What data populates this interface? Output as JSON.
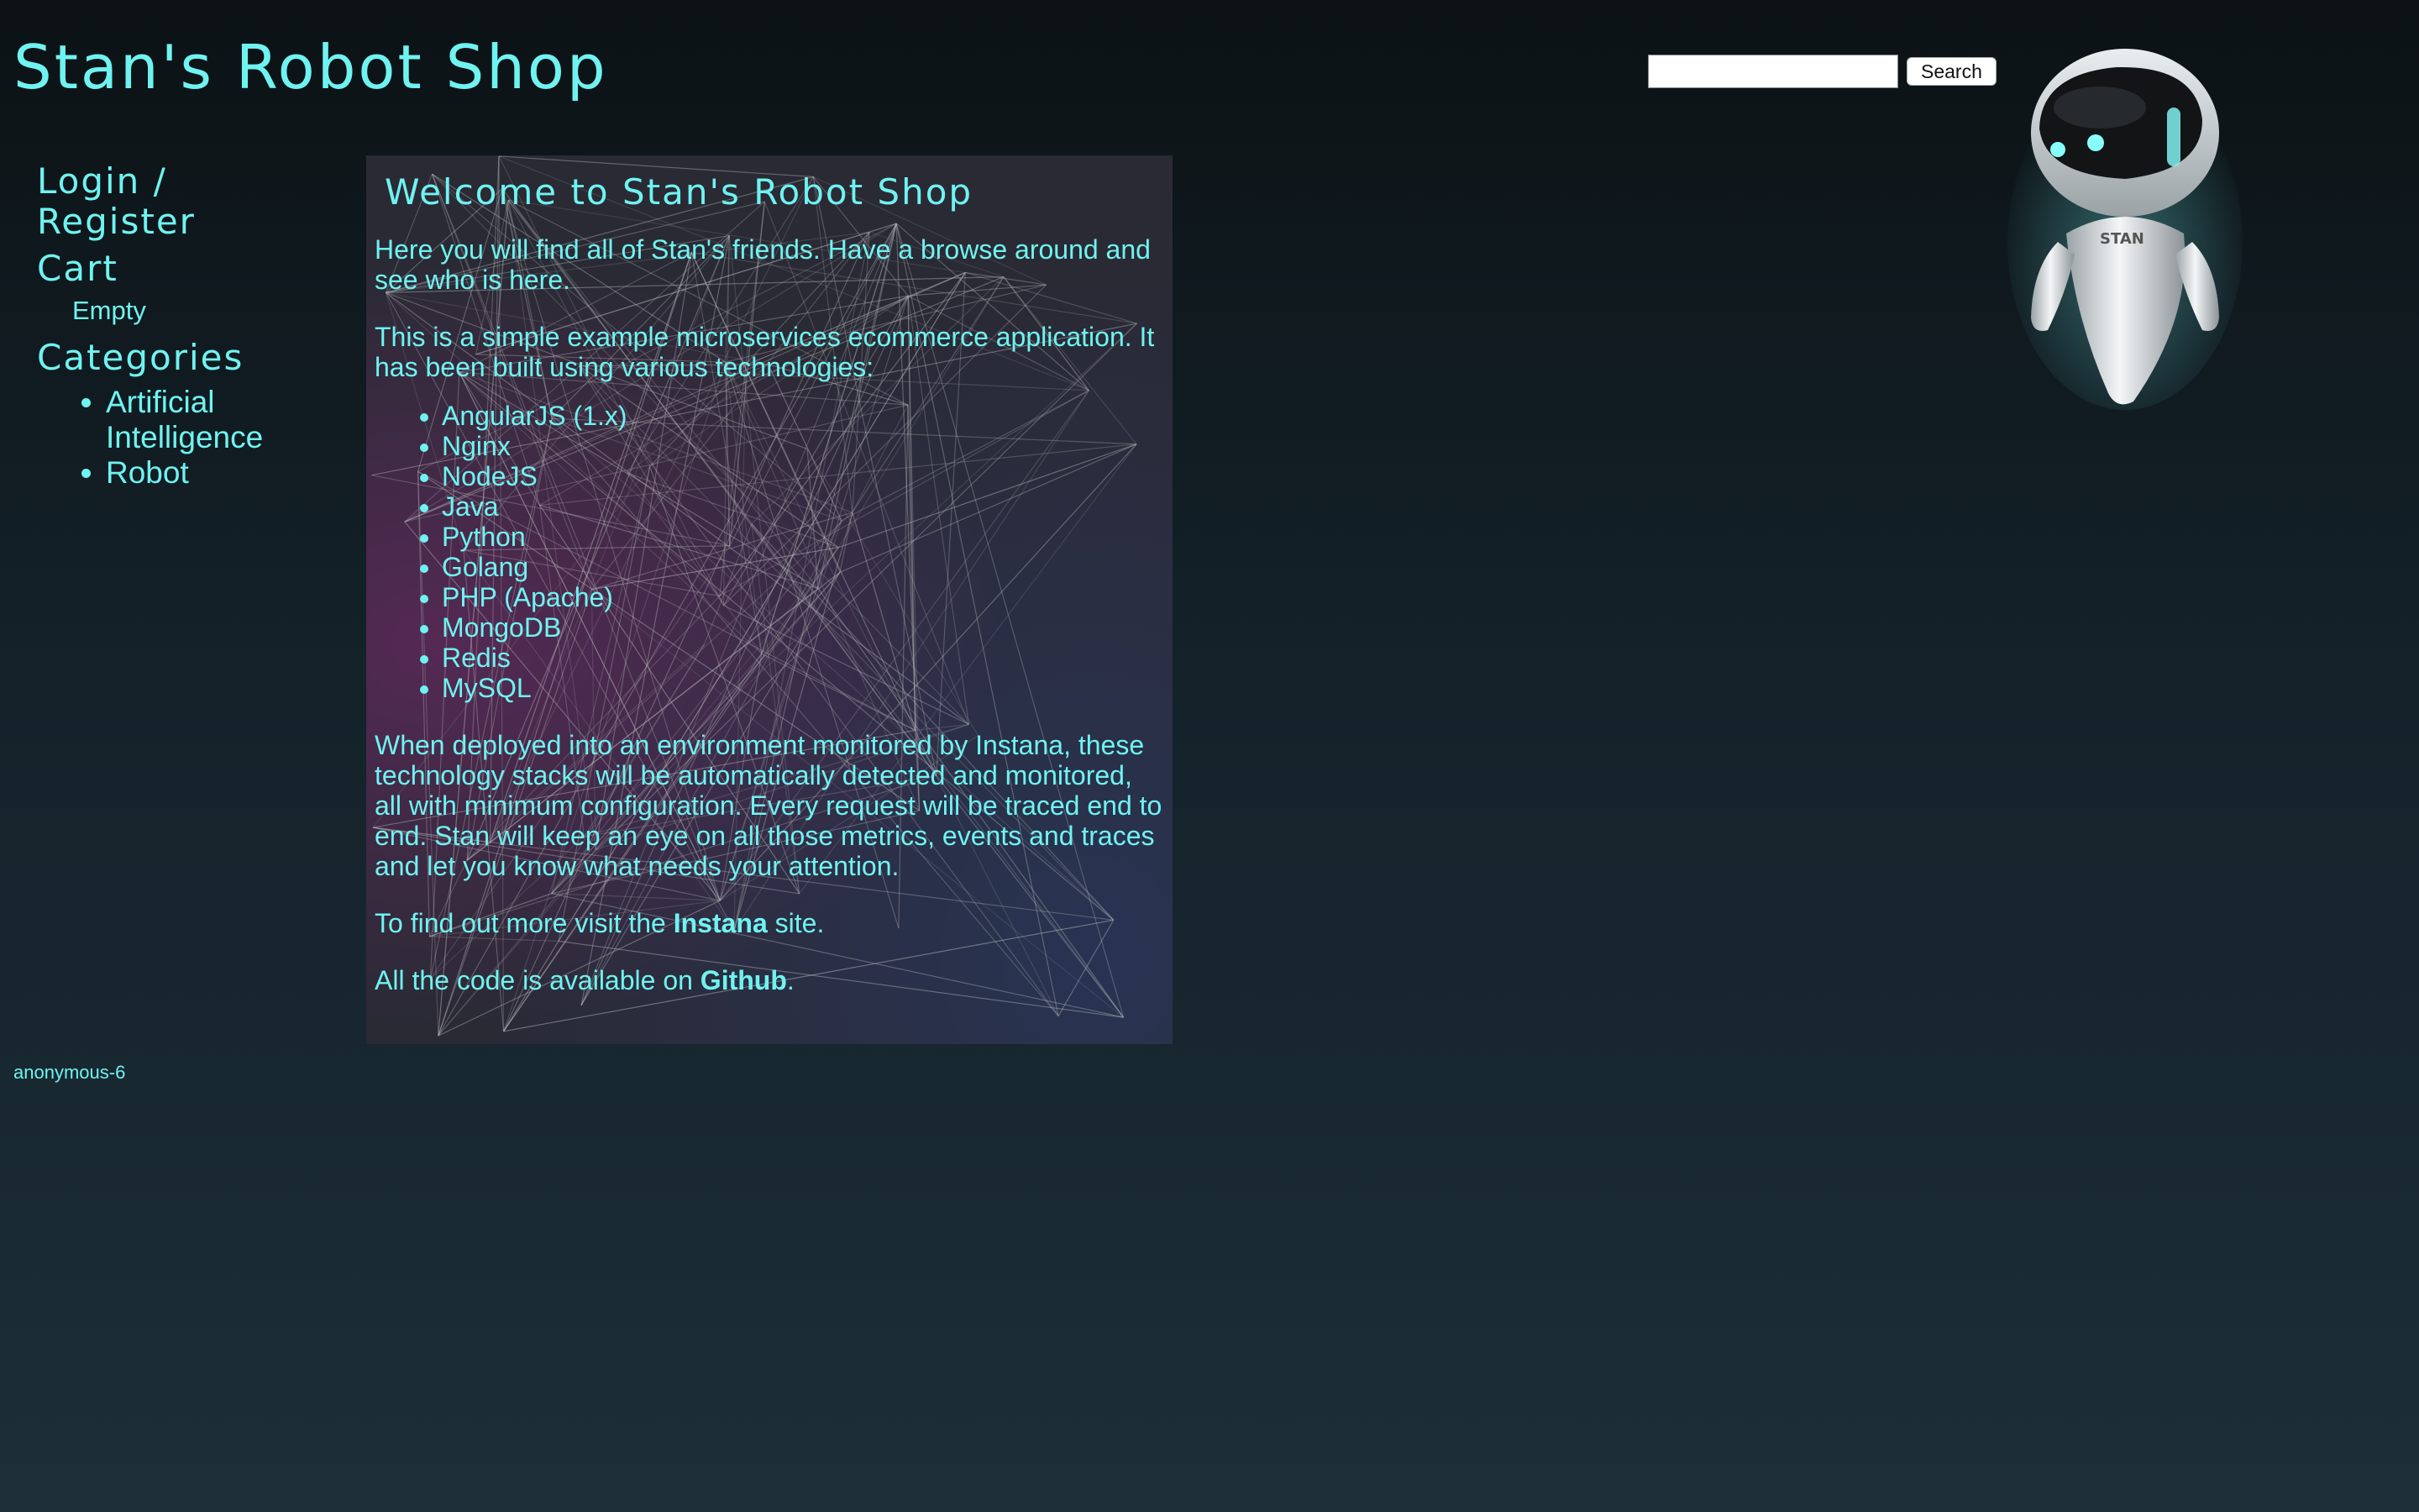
{
  "header": {
    "title": "Stan's Robot Shop",
    "search_placeholder": "",
    "search_button": "Search"
  },
  "sidebar": {
    "login_label": "Login / Register",
    "cart_label": "Cart",
    "cart_status": "Empty",
    "categories_label": "Categories",
    "categories": [
      "Artificial Intelligence",
      "Robot"
    ]
  },
  "main": {
    "heading": "Welcome to Stan's Robot Shop",
    "intro": "Here you will find all of Stan's friends. Have a browse around and see who is here.",
    "description": "This is a simple example microservices ecommerce application. It has been built using various technologies:",
    "technologies": [
      "AngularJS (1.x)",
      "Nginx",
      "NodeJS",
      "Java",
      "Python",
      "Golang",
      "PHP (Apache)",
      "MongoDB",
      "Redis",
      "MySQL"
    ],
    "monitoring": "When deployed into an environment monitored by Instana, these technology stacks will be automatically detected and monitored, all with minimum configuration. Every request will be traced end to end. Stan will keep an eye on all those metrics, events and traces and let you know what needs your attention.",
    "more_prefix": "To find out more visit the ",
    "more_link": "Instana",
    "more_suffix": " site.",
    "code_prefix": "All the code is available on ",
    "code_link": "Github",
    "code_suffix": "."
  },
  "robot_logo_text": "STAN",
  "footer": {
    "user": "anonymous-6"
  },
  "colors": {
    "accent": "#6ff3f0",
    "background_top": "#0c1215",
    "background_bottom": "#1d2e36"
  }
}
